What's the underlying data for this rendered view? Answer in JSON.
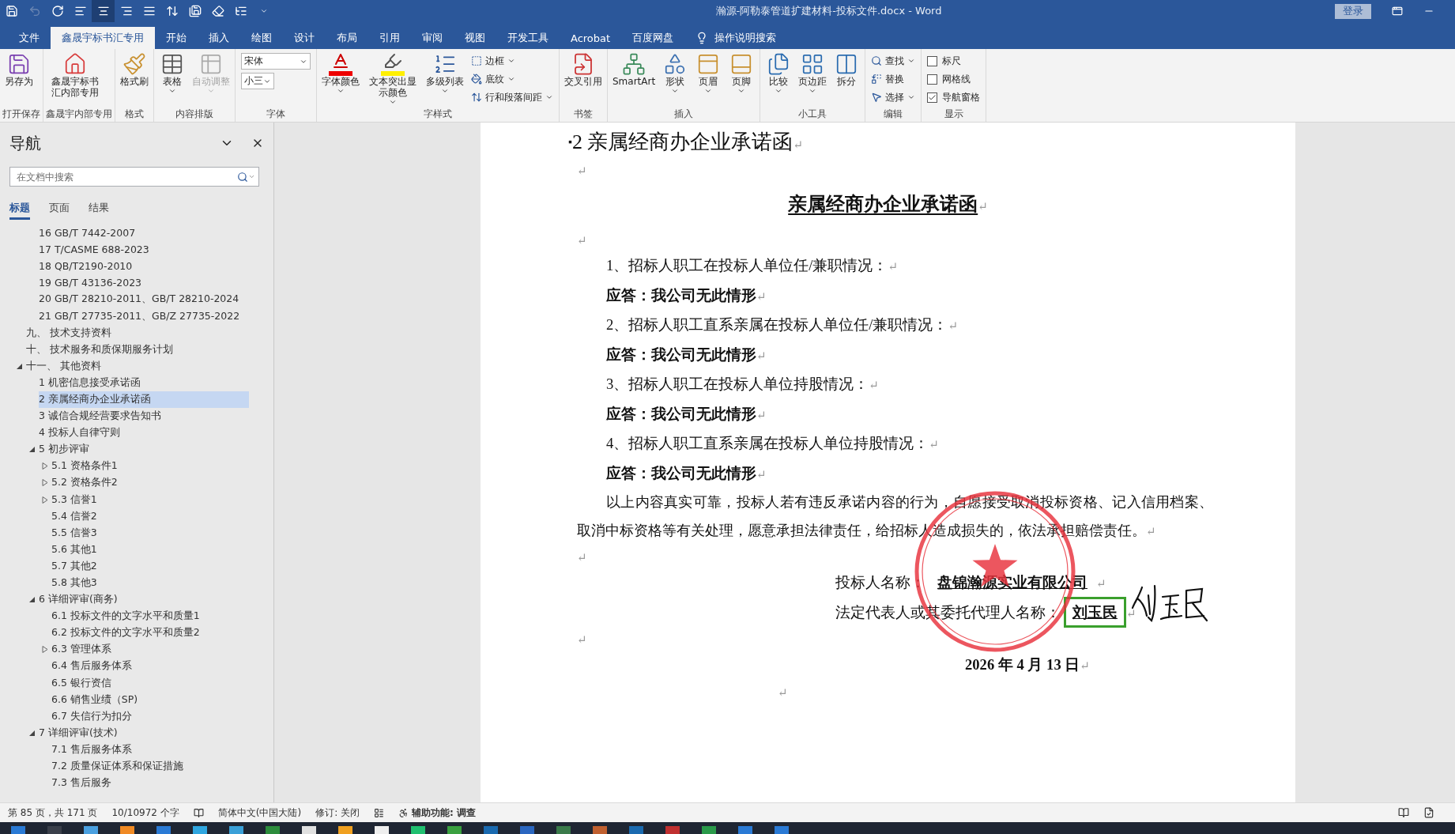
{
  "title_bar": {
    "quick_access": [
      {
        "selected": false,
        "disabled": false
      },
      {
        "selected": false,
        "disabled": true
      },
      {
        "selected": false,
        "disabled": false
      },
      {
        "selected": false,
        "disabled": false
      },
      {
        "selected": true,
        "disabled": false
      },
      {
        "selected": false,
        "disabled": false
      },
      {
        "selected": false,
        "disabled": false
      },
      {
        "selected": false,
        "disabled": false
      },
      {
        "selected": false,
        "disabled": false
      },
      {
        "selected": false,
        "disabled": false
      },
      {
        "selected": false,
        "disabled": false
      },
      {
        "selected": false,
        "disabled": false
      }
    ],
    "title": "瀚源-阿勒泰管道扩建材料-投标文件.docx  -  Word",
    "login": "登录"
  },
  "menu_tabs": [
    {
      "label": "文件",
      "selected": false
    },
    {
      "label": "鑫晟宇标书汇专用",
      "selected": true
    },
    {
      "label": "开始",
      "selected": false
    },
    {
      "label": "插入",
      "selected": false
    },
    {
      "label": "绘图",
      "selected": false
    },
    {
      "label": "设计",
      "selected": false
    },
    {
      "label": "布局",
      "selected": false
    },
    {
      "label": "引用",
      "selected": false
    },
    {
      "label": "审阅",
      "selected": false
    },
    {
      "label": "视图",
      "selected": false
    },
    {
      "label": "开发工具",
      "selected": false
    },
    {
      "label": "Acrobat",
      "selected": false
    },
    {
      "label": "百度网盘",
      "selected": false
    }
  ],
  "tell_me": "操作说明搜索",
  "ribbon": [
    {
      "label": "打开保存",
      "items": [
        {
          "kind": "large",
          "label": "另存为",
          "dropdown": false,
          "disabled": false
        }
      ]
    },
    {
      "label": "鑫晟宇内部专用",
      "items": [
        {
          "kind": "large",
          "label": "鑫晟宇标书汇内部专用",
          "dropdown": false,
          "disabled": false
        }
      ]
    },
    {
      "label": "格式",
      "items": [
        {
          "kind": "large",
          "label": "格式刷",
          "dropdown": false,
          "disabled": false
        }
      ]
    },
    {
      "label": "内容排版",
      "items": [
        {
          "kind": "large",
          "label": "表格",
          "dropdown": true,
          "disabled": false
        },
        {
          "kind": "large",
          "label": "自动调整",
          "dropdown": true,
          "disabled": true
        }
      ]
    },
    {
      "label": "字体",
      "items": [
        {
          "kind": "font",
          "font": "宋体",
          "size": "小三"
        }
      ]
    },
    {
      "label": "字样式",
      "items": [
        {
          "kind": "large",
          "label": "字体颜色",
          "dropdown": true,
          "disabled": false
        },
        {
          "kind": "large",
          "label": "文本突出显示颜色",
          "dropdown": true,
          "disabled": false
        },
        {
          "kind": "large",
          "label": "多级列表",
          "dropdown": true,
          "disabled": false
        },
        {
          "kind": "stack",
          "items": [
            {
              "label": "边框",
              "dropdown": true
            },
            {
              "label": "底纹",
              "dropdown": true
            },
            {
              "label": "行和段落间距",
              "dropdown": true
            }
          ]
        }
      ]
    },
    {
      "label": "书签",
      "items": [
        {
          "kind": "large",
          "label": "交叉引用",
          "dropdown": false,
          "disabled": false
        }
      ]
    },
    {
      "label": "插入",
      "items": [
        {
          "kind": "large",
          "label": "SmartArt",
          "dropdown": false,
          "disabled": false
        },
        {
          "kind": "large",
          "label": "形状",
          "dropdown": true,
          "disabled": false
        },
        {
          "kind": "large",
          "label": "页眉",
          "dropdown": true,
          "disabled": false
        },
        {
          "kind": "large",
          "label": "页脚",
          "dropdown": true,
          "disabled": false
        }
      ]
    },
    {
      "label": "小工具",
      "items": [
        {
          "kind": "large",
          "label": "比较",
          "dropdown": true,
          "disabled": false
        },
        {
          "kind": "large",
          "label": "页边距",
          "dropdown": true,
          "disabled": false
        },
        {
          "kind": "large",
          "label": "拆分",
          "dropdown": false,
          "disabled": false
        }
      ]
    },
    {
      "label": "编辑",
      "items": [
        {
          "kind": "stack",
          "items": [
            {
              "label": "查找",
              "dropdown": true
            },
            {
              "label": "替换",
              "dropdown": false
            },
            {
              "label": "选择",
              "dropdown": true
            }
          ]
        }
      ]
    },
    {
      "label": "显示",
      "items": [
        {
          "kind": "checks",
          "items": [
            {
              "label": "标尺",
              "checked": false
            },
            {
              "label": "网格线",
              "checked": false
            },
            {
              "label": "导航窗格",
              "checked": true
            }
          ]
        }
      ]
    }
  ],
  "nav": {
    "title": "导航",
    "search_placeholder": "在文档中搜索",
    "tabs": [
      {
        "label": "标题",
        "selected": true
      },
      {
        "label": "页面",
        "selected": false
      },
      {
        "label": "结果",
        "selected": false
      }
    ],
    "tree": [
      {
        "children": [
          {
            "label": "16 GB/T 7442-2007",
            "selected": false
          },
          {
            "label": "17 T/CASME 688-2023",
            "selected": false
          },
          {
            "label": "18 QB/T2190-2010",
            "selected": false
          },
          {
            "label": "19 GB/T 43136-2023",
            "selected": false
          },
          {
            "label": "20 GB/T 28210-2011、GB/T 28210-2024",
            "selected": false
          },
          {
            "label": "21 GB/T 27735-2011、GB/Z 27735-2022",
            "selected": false
          }
        ]
      },
      {
        "label": "九、 技术支持资料",
        "selected": false
      },
      {
        "label": "十、 技术服务和质保期服务计划",
        "selected": false
      },
      {
        "label": "十一、 其他资料",
        "selected": false,
        "expanded": true,
        "children": [
          {
            "label": "1 机密信息接受承诺函",
            "selected": false
          },
          {
            "label": "2 亲属经商办企业承诺函",
            "selected": true
          },
          {
            "label": "3 诚信合规经营要求告知书",
            "selected": false
          },
          {
            "label": "4 投标人自律守则",
            "selected": false
          },
          {
            "label": "5 初步评审",
            "selected": false,
            "expanded": true,
            "children": [
              {
                "label": "5.1 资格条件1",
                "selected": false,
                "expanded": false
              },
              {
                "label": "5.2 资格条件2",
                "selected": false,
                "expanded": false
              },
              {
                "label": "5.3 信誉1",
                "selected": false,
                "expanded": false
              },
              {
                "label": "5.4 信誉2",
                "selected": false
              },
              {
                "label": "5.5 信誉3",
                "selected": false
              },
              {
                "label": "5.6 其他1",
                "selected": false
              },
              {
                "label": "5.7 其他2",
                "selected": false
              },
              {
                "label": "5.8 其他3",
                "selected": false
              }
            ]
          },
          {
            "label": "6 详细评审(商务)",
            "selected": false,
            "expanded": true,
            "children": [
              {
                "label": "6.1 投标文件的文字水平和质量1",
                "selected": false
              },
              {
                "label": "6.2 投标文件的文字水平和质量2",
                "selected": false
              },
              {
                "label": "6.3 管理体系",
                "selected": false,
                "expanded": false
              },
              {
                "label": "6.4 售后服务体系",
                "selected": false
              },
              {
                "label": "6.5 银行资信",
                "selected": false
              },
              {
                "label": "6.6 销售业绩（SP)",
                "selected": false
              },
              {
                "label": "6.7 失信行为扣分",
                "selected": false
              }
            ]
          },
          {
            "label": "7 详细评审(技术)",
            "selected": false,
            "expanded": true,
            "children": [
              {
                "label": "7.1 售后服务体系",
                "selected": false
              },
              {
                "label": "7.2 质量保证体系和保证措施",
                "selected": false
              },
              {
                "label": "7.3 售后服务",
                "selected": false
              }
            ]
          }
        ]
      }
    ]
  },
  "document": {
    "paragraphs": [
      {
        "kind": "heading",
        "bullet": "▪",
        "text": "2 亲属经商办企业承诺函",
        "end_mark": "↵"
      },
      {
        "kind": "empty",
        "end_mark": "↵"
      },
      {
        "kind": "title",
        "text": "亲属经商办企业承诺函",
        "end_mark": "↵"
      },
      {
        "kind": "empty",
        "end_mark": "↵"
      },
      {
        "kind": "item",
        "text": "1、招标人职工在投标人单位任/兼职情况：",
        "end_mark": "↵"
      },
      {
        "kind": "answer",
        "text": "应答：我公司无此情形",
        "end_mark": "↵"
      },
      {
        "kind": "item",
        "text": "2、招标人职工直系亲属在投标人单位任/兼职情况：",
        "end_mark": "↵"
      },
      {
        "kind": "answer",
        "text": "应答：我公司无此情形",
        "end_mark": "↵"
      },
      {
        "kind": "item",
        "text": "3、招标人职工在投标人单位持股情况：",
        "end_mark": "↵"
      },
      {
        "kind": "answer",
        "text": "应答：我公司无此情形",
        "end_mark": "↵"
      },
      {
        "kind": "item",
        "text": "4、招标人职工直系亲属在投标人单位持股情况：",
        "end_mark": "↵"
      },
      {
        "kind": "answer",
        "text": "应答：我公司无此情形",
        "end_mark": "↵"
      },
      {
        "kind": "body",
        "text": "以上内容真实可靠，投标人若有违反承诺内容的行为，自愿接受取消投标资格、记入信用档案、取消中标资格等有关处理，愿意承担法律责任，给招标人造成损失的，依法承担赔偿责任。",
        "end_mark": "↵"
      },
      {
        "kind": "empty",
        "end_mark": "↵"
      },
      {
        "kind": "signature",
        "label": "投标人名称：",
        "value": "盘锦瀚源实业有限公司",
        "framed": false,
        "end_mark": "↵"
      },
      {
        "kind": "signature",
        "label": "法定代表人或其委托代理人名称：",
        "value": "刘玉民",
        "framed": true,
        "end_mark": "↵"
      },
      {
        "kind": "empty",
        "end_mark": "↵"
      },
      {
        "kind": "date",
        "text": "2026 年 4 月 13 日",
        "end_mark": "↵"
      },
      {
        "kind": "footer",
        "end_mark": "↵"
      }
    ]
  },
  "status_bar": {
    "page": "第 85 页，共 171 页",
    "words": "10/10972 个字",
    "language": "简体中文(中国大陆)",
    "track_changes": "修订: 关闭",
    "accessibility": "辅助功能: 调查"
  }
}
